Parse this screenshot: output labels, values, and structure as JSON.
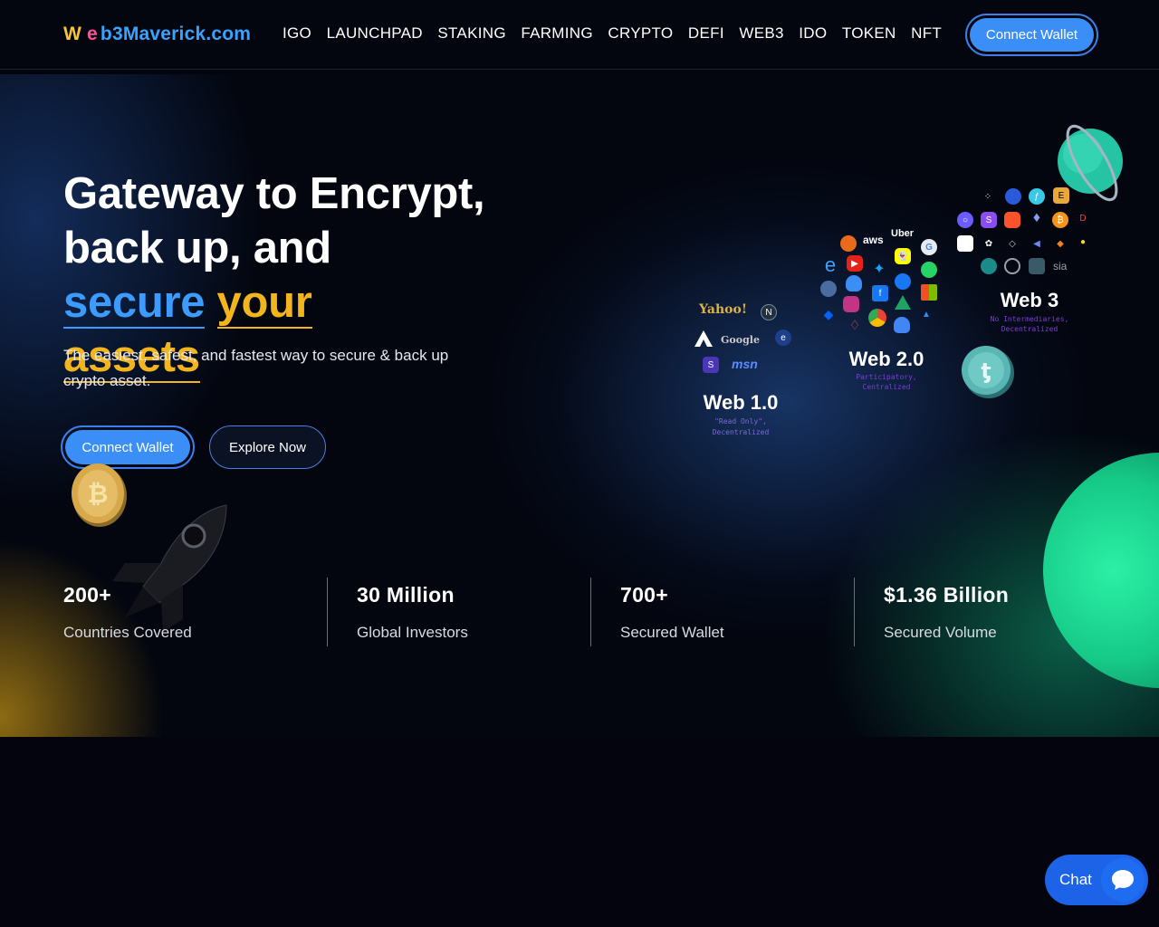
{
  "header": {
    "logo": {
      "w": "W",
      "e": "e",
      "rest": "b3Maverick.com"
    },
    "nav": [
      "IGO",
      "LAUNCHPAD",
      "STAKING",
      "FARMING",
      "CRYPTO",
      "DEFI",
      "WEB3",
      "IDO",
      "TOKEN",
      "NFT"
    ],
    "connect_label": "Connect Wallet"
  },
  "hero": {
    "title_line1": "Gateway to Encrypt,",
    "title_line2_plain": "back up, and ",
    "title_line2_blue": "secure",
    "title_line2_gold": "your",
    "title_line3_gold": "assets",
    "subtitle": "The easiest, safest, and fastest way to secure & back up crypto asset.",
    "primary_button": "Connect Wallet",
    "secondary_button": "Explore Now"
  },
  "illustration": {
    "web1": {
      "title": "Web 1.0",
      "note1": "\"Read Only\",",
      "note2": "Decentralized",
      "brands": [
        "Yahoo!",
        "Google",
        "msn"
      ]
    },
    "web2": {
      "title": "Web 2.0",
      "note1": "Participatory,",
      "note2": "Centralized",
      "brands": [
        "aws",
        "Uber"
      ]
    },
    "web3": {
      "title": "Web 3",
      "note1": "No Intermediaries,",
      "note2": "Decentralized",
      "brands": [
        "sia"
      ]
    }
  },
  "stats": [
    {
      "value": "200+",
      "label": "Countries Covered"
    },
    {
      "value": "30 Million",
      "label": "Global Investors"
    },
    {
      "value": "700+",
      "label": "Secured Wallet"
    },
    {
      "value": "$1.36 Billion",
      "label": "Secured Volume"
    }
  ],
  "chat": {
    "label": "Chat"
  },
  "colors": {
    "accent_blue": "#3a8ef6",
    "accent_gold": "#f2b51d",
    "logo_pink": "#ff4f9a",
    "green": "#16c987"
  }
}
